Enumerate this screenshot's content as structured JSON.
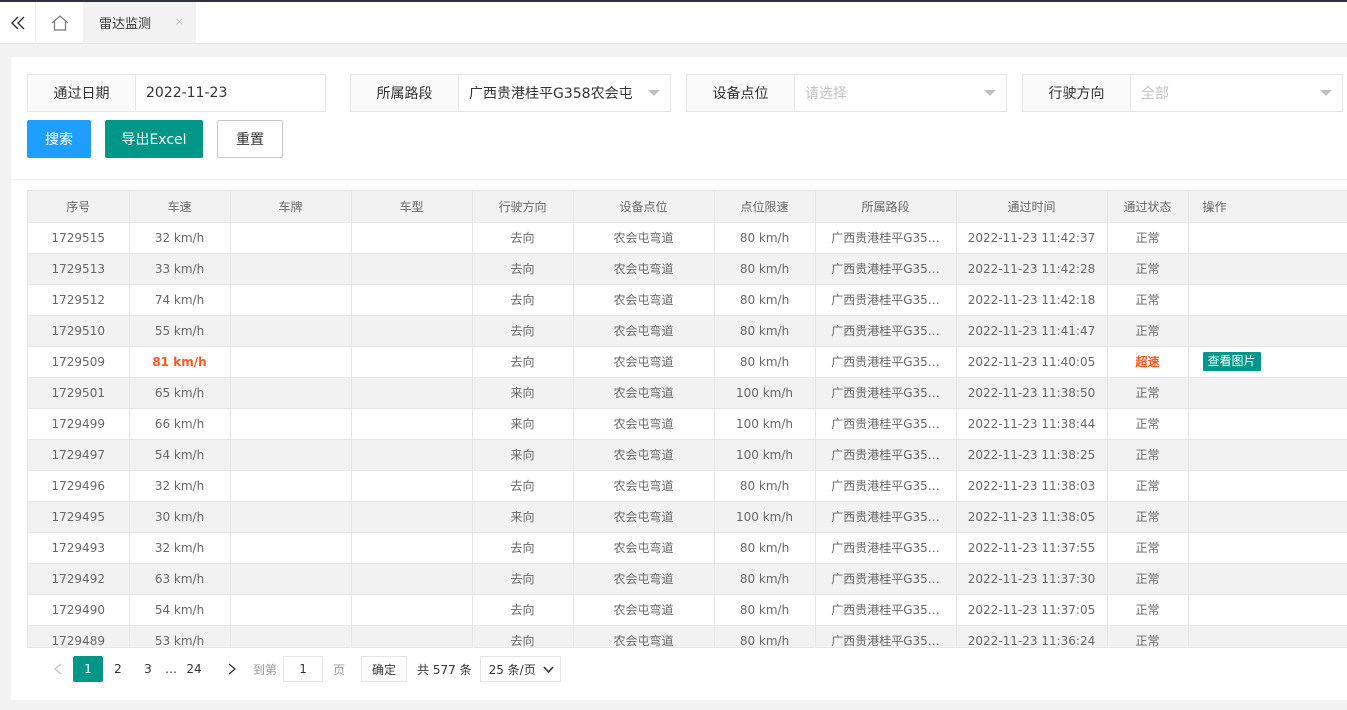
{
  "tabs": {
    "active_label": "雷达监测",
    "close_glyph": "×"
  },
  "filters": {
    "date": {
      "label": "通过日期",
      "value": "2022-11-23"
    },
    "road": {
      "label": "所属路段",
      "value": "广西贵港桂平G358农会屯"
    },
    "device": {
      "label": "设备点位",
      "placeholder": "请选择"
    },
    "direction": {
      "label": "行驶方向",
      "placeholder": "全部"
    }
  },
  "buttons": {
    "search": "搜索",
    "export": "导出Excel",
    "reset": "重置"
  },
  "table": {
    "headers": [
      "序号",
      "车速",
      "车牌",
      "车型",
      "行驶方向",
      "设备点位",
      "点位限速",
      "所属路段",
      "通过时间",
      "通过状态",
      "操作"
    ],
    "action_label": "查看图片",
    "rows": [
      {
        "id": "1729515",
        "speed": "32 km/h",
        "plate": "",
        "type": "",
        "dir": "去向",
        "device": "农会屯弯道",
        "limit": "80 km/h",
        "road": "广西贵港桂平G35…",
        "time": "2022-11-23 11:42:37",
        "status": "正常",
        "over": false
      },
      {
        "id": "1729513",
        "speed": "33 km/h",
        "plate": "",
        "type": "",
        "dir": "去向",
        "device": "农会屯弯道",
        "limit": "80 km/h",
        "road": "广西贵港桂平G35…",
        "time": "2022-11-23 11:42:28",
        "status": "正常",
        "over": false
      },
      {
        "id": "1729512",
        "speed": "74 km/h",
        "plate": "",
        "type": "",
        "dir": "去向",
        "device": "农会屯弯道",
        "limit": "80 km/h",
        "road": "广西贵港桂平G35…",
        "time": "2022-11-23 11:42:18",
        "status": "正常",
        "over": false
      },
      {
        "id": "1729510",
        "speed": "55 km/h",
        "plate": "",
        "type": "",
        "dir": "去向",
        "device": "农会屯弯道",
        "limit": "80 km/h",
        "road": "广西贵港桂平G35…",
        "time": "2022-11-23 11:41:47",
        "status": "正常",
        "over": false
      },
      {
        "id": "1729509",
        "speed": "81 km/h",
        "plate": "",
        "type": "",
        "dir": "去向",
        "device": "农会屯弯道",
        "limit": "80 km/h",
        "road": "广西贵港桂平G35…",
        "time": "2022-11-23 11:40:05",
        "status": "超速",
        "over": true
      },
      {
        "id": "1729501",
        "speed": "65 km/h",
        "plate": "",
        "type": "",
        "dir": "来向",
        "device": "农会屯弯道",
        "limit": "100 km/h",
        "road": "广西贵港桂平G35…",
        "time": "2022-11-23 11:38:50",
        "status": "正常",
        "over": false
      },
      {
        "id": "1729499",
        "speed": "66 km/h",
        "plate": "",
        "type": "",
        "dir": "来向",
        "device": "农会屯弯道",
        "limit": "100 km/h",
        "road": "广西贵港桂平G35…",
        "time": "2022-11-23 11:38:44",
        "status": "正常",
        "over": false
      },
      {
        "id": "1729497",
        "speed": "54 km/h",
        "plate": "",
        "type": "",
        "dir": "来向",
        "device": "农会屯弯道",
        "limit": "100 km/h",
        "road": "广西贵港桂平G35…",
        "time": "2022-11-23 11:38:25",
        "status": "正常",
        "over": false
      },
      {
        "id": "1729496",
        "speed": "32 km/h",
        "plate": "",
        "type": "",
        "dir": "去向",
        "device": "农会屯弯道",
        "limit": "80 km/h",
        "road": "广西贵港桂平G35…",
        "time": "2022-11-23 11:38:03",
        "status": "正常",
        "over": false
      },
      {
        "id": "1729495",
        "speed": "30 km/h",
        "plate": "",
        "type": "",
        "dir": "来向",
        "device": "农会屯弯道",
        "limit": "100 km/h",
        "road": "广西贵港桂平G35…",
        "time": "2022-11-23 11:38:05",
        "status": "正常",
        "over": false
      },
      {
        "id": "1729493",
        "speed": "32 km/h",
        "plate": "",
        "type": "",
        "dir": "去向",
        "device": "农会屯弯道",
        "limit": "80 km/h",
        "road": "广西贵港桂平G35…",
        "time": "2022-11-23 11:37:55",
        "status": "正常",
        "over": false
      },
      {
        "id": "1729492",
        "speed": "63 km/h",
        "plate": "",
        "type": "",
        "dir": "去向",
        "device": "农会屯弯道",
        "limit": "80 km/h",
        "road": "广西贵港桂平G35…",
        "time": "2022-11-23 11:37:30",
        "status": "正常",
        "over": false
      },
      {
        "id": "1729490",
        "speed": "54 km/h",
        "plate": "",
        "type": "",
        "dir": "去向",
        "device": "农会屯弯道",
        "limit": "80 km/h",
        "road": "广西贵港桂平G35…",
        "time": "2022-11-23 11:37:05",
        "status": "正常",
        "over": false
      },
      {
        "id": "1729489",
        "speed": "53 km/h",
        "plate": "",
        "type": "",
        "dir": "去向",
        "device": "农会屯弯道",
        "limit": "80 km/h",
        "road": "广西贵港桂平G35…",
        "time": "2022-11-23 11:36:24",
        "status": "正常",
        "over": false
      }
    ]
  },
  "pagination": {
    "pages": [
      "1",
      "2",
      "3"
    ],
    "current": "1",
    "ellipsis": "…",
    "last_page": "24",
    "goto_label": "到第",
    "goto_value": "1",
    "page_unit": "页",
    "confirm": "确定",
    "total": "共 577 条",
    "page_size": "25 条/页"
  },
  "colors": {
    "primary_blue": "#1E9FFF",
    "primary_green": "#009688",
    "warn_orange": "#FF5722"
  }
}
